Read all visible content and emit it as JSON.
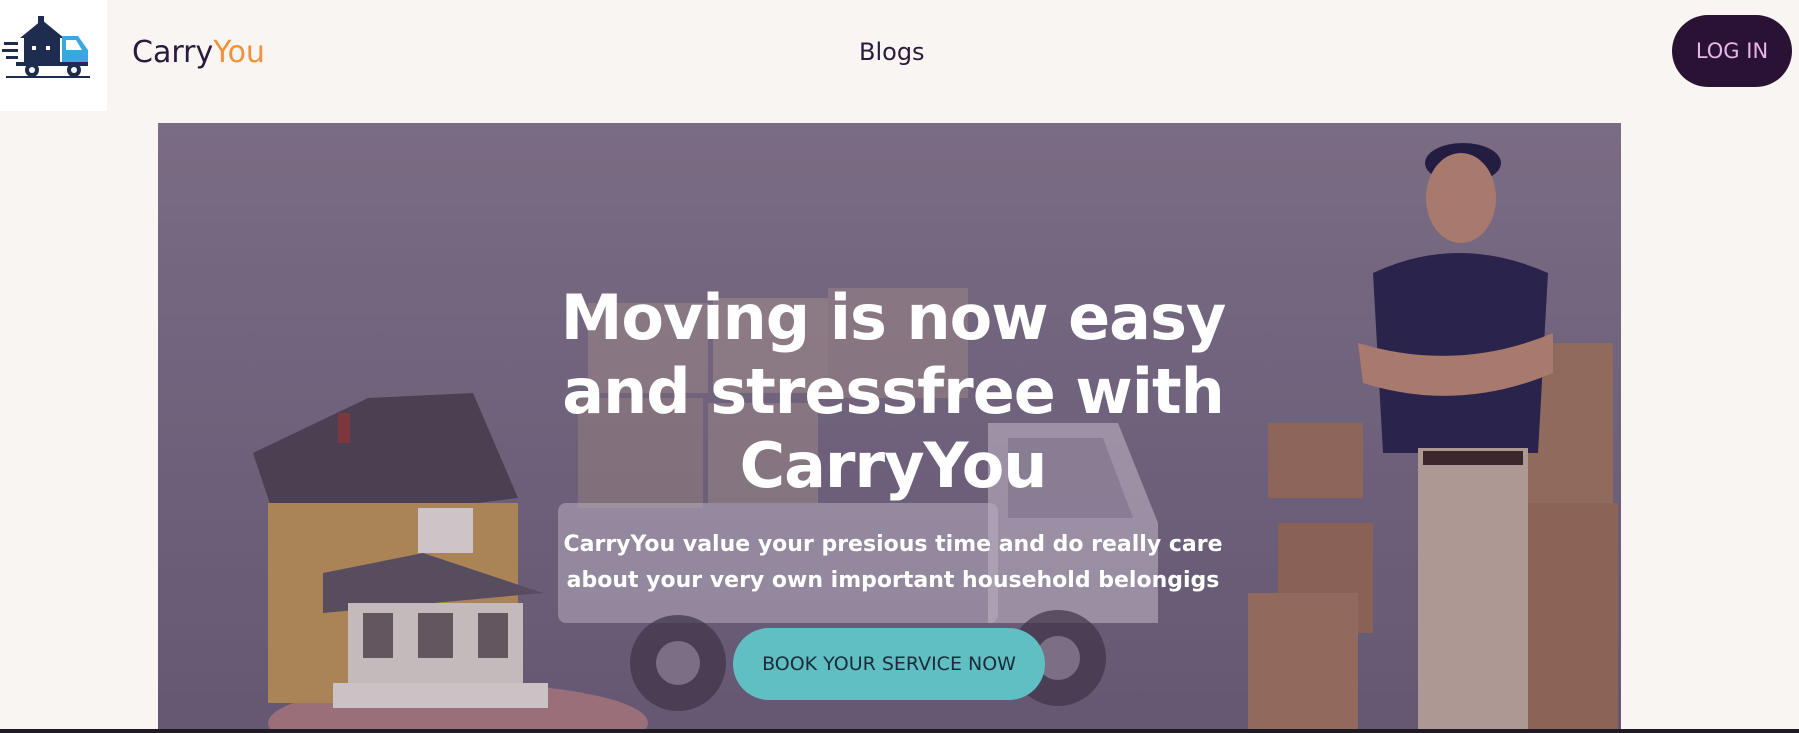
{
  "header": {
    "brand_part1": "Carry",
    "brand_part2": "You",
    "nav_blogs": "Blogs",
    "login_label": "LOG IN"
  },
  "hero": {
    "headline": "Moving is now easy and stressfree with CarryYou",
    "subtext": "CarryYou value your presious time and do really care about your very own important household belongigs",
    "cta_label": "BOOK YOUR SERVICE NOW"
  },
  "icons": {
    "logo": "moving-truck-house-logo"
  },
  "colors": {
    "background": "#f9f5f2",
    "brand_dark": "#2a1b3d",
    "brand_accent": "#f0923b",
    "login_bg": "#2a1235",
    "login_text": "#e8b6e6",
    "cta_bg": "#5fbfc3",
    "hero_overlay": "#7a6f84"
  }
}
